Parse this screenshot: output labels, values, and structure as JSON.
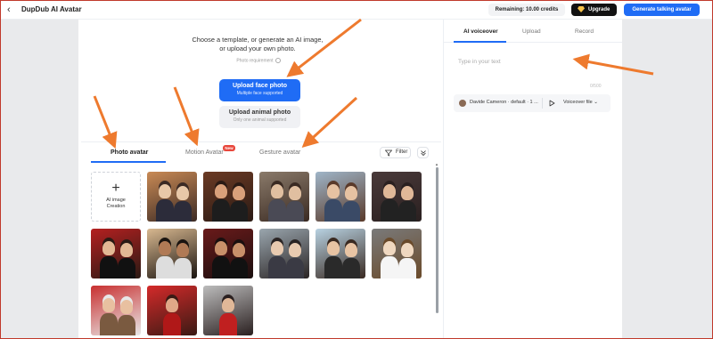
{
  "header": {
    "back_icon": "chevron-left-icon",
    "title": "DupDub AI Avatar",
    "credits": "Remaining: 10.00 credits",
    "upgrade_label": "Upgrade",
    "generate_label": "Generate talking avatar"
  },
  "upload": {
    "intro_line1": "Choose a template, or generate an AI image,",
    "intro_line2": "or upload your own photo.",
    "photo_requirement": "Photo requirement",
    "face_title": "Upload face photo",
    "face_sub": "Multiple face supported",
    "animal_title": "Upload animal photo",
    "animal_sub": "Only one animal supported"
  },
  "tabs": {
    "photo": "Photo avatar",
    "motion": "Motion Avatar",
    "new_badge": "New",
    "gesture": "Gesture avatar",
    "filter": "Filter"
  },
  "grid": {
    "ai_creation_label": "AI image Creation",
    "tiles": [
      {
        "scene": "city-street-couple-evening"
      },
      {
        "scene": "couple-warm-lights"
      },
      {
        "scene": "couple-old-town"
      },
      {
        "scene": "couple-hot-air-balloons"
      },
      {
        "scene": "couple-street-lanterns"
      },
      {
        "scene": "couple-red-background-formal"
      },
      {
        "scene": "couple-colorful-lights"
      },
      {
        "scene": "couple-red-party"
      },
      {
        "scene": "couple-winter-street"
      },
      {
        "scene": "couple-beach"
      },
      {
        "scene": "couple-wedding"
      },
      {
        "scene": "elderly-couple-santa-hat"
      },
      {
        "scene": "woman-red-dress-balloons"
      },
      {
        "scene": "man-red-heart-balloon"
      }
    ]
  },
  "voice": {
    "tabs": [
      "AI voiceover",
      "Upload",
      "Record"
    ],
    "placeholder": "Type in your text",
    "counter": "0/500",
    "speaker": "Davide Cameron · default · 1 ...",
    "voiceover_file": "Voiceover file"
  },
  "colors": {
    "accent": "#1f6cf5",
    "annotation_arrow": "#ee7a2e",
    "new_badge": "#e8473c"
  }
}
